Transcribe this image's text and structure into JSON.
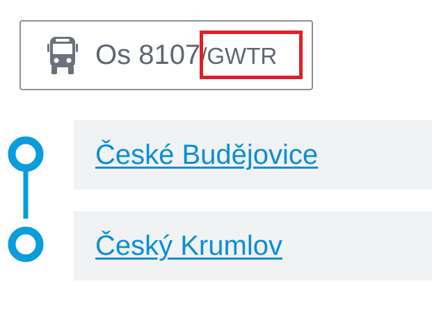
{
  "train": {
    "number": "Os 8107",
    "carrier": "/GWTR",
    "icon": "bus-icon"
  },
  "stops": [
    {
      "name": "České Budějovice"
    },
    {
      "name": "Český Krumlov"
    }
  ],
  "colors": {
    "link": "#0a8fd4",
    "route": "#0a9ddc",
    "highlight": "#e01f26",
    "badge_border": "#8a9099",
    "row_background": "#f1f2f3",
    "text_gray": "#5f6670"
  }
}
